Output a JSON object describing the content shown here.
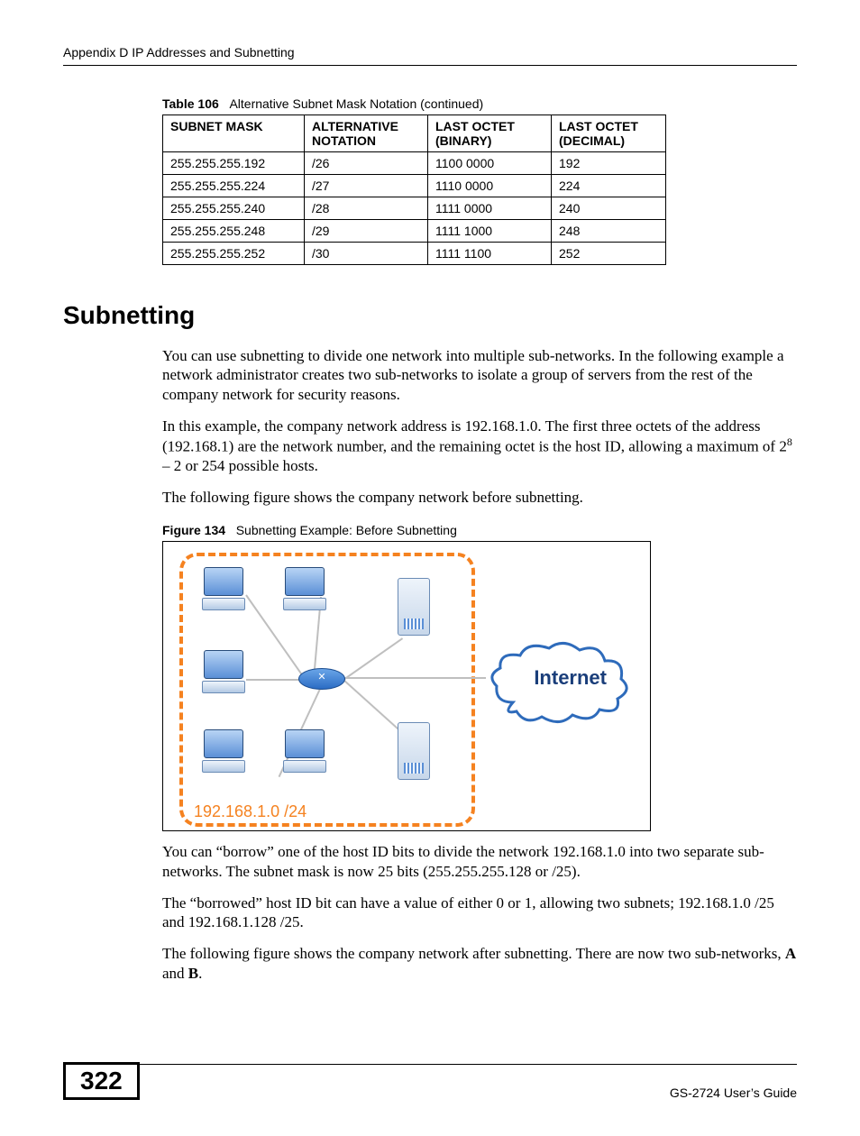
{
  "running_head": "Appendix D IP Addresses and Subnetting",
  "table": {
    "label": "Table 106",
    "title": "Alternative Subnet Mask Notation (continued)",
    "headers": [
      "SUBNET MASK",
      "ALTERNATIVE NOTATION",
      "LAST OCTET (BINARY)",
      "LAST OCTET (DECIMAL)"
    ],
    "rows": [
      [
        "255.255.255.192",
        "/26",
        "1100 0000",
        "192"
      ],
      [
        "255.255.255.224",
        "/27",
        "1110 0000",
        "224"
      ],
      [
        "255.255.255.240",
        "/28",
        "1111 0000",
        "240"
      ],
      [
        "255.255.255.248",
        "/29",
        "1111 1000",
        "248"
      ],
      [
        "255.255.255.252",
        "/30",
        "1111 1100",
        "252"
      ]
    ]
  },
  "section_title": "Subnetting",
  "paragraphs": {
    "p1": "You can use subnetting to divide one network into multiple sub-networks. In the following example a network administrator creates two sub-networks to isolate a group of servers from the rest of the company network for security reasons.",
    "p2_a": "In this example, the company network address is 192.168.1.0. The first three octets of the address (192.168.1) are the network number, and the remaining octet is the host ID, allowing a maximum of 2",
    "p2_sup": "8",
    "p2_b": " – 2 or 254 possible hosts.",
    "p3": "The following figure shows the company network before subnetting.",
    "p4": "You can “borrow” one of the host ID bits to divide the network 192.168.1.0 into two separate sub-networks. The subnet mask is now 25 bits (255.255.255.128 or /25).",
    "p5": "The “borrowed” host ID bit can have a value of either 0 or 1, allowing two subnets; 192.168.1.0 /25 and 192.168.1.128 /25.",
    "p6_a": "The following figure shows the company network after subnetting. There are now two sub-networks, ",
    "p6_b": "A",
    "p6_c": " and ",
    "p6_d": "B",
    "p6_e": "."
  },
  "figure": {
    "label": "Figure 134",
    "title": "Subnetting Example: Before Subnetting",
    "net_label": "192.168.1.0 /24",
    "cloud_label": "Internet"
  },
  "chart_data": {
    "type": "diagram",
    "description": "Network topology before subnetting",
    "nodes": [
      {
        "id": "router",
        "type": "router"
      },
      {
        "id": "pc1",
        "type": "workstation"
      },
      {
        "id": "pc2",
        "type": "workstation"
      },
      {
        "id": "pc3",
        "type": "workstation"
      },
      {
        "id": "pc4",
        "type": "workstation"
      },
      {
        "id": "srv1",
        "type": "server"
      },
      {
        "id": "srv2",
        "type": "server"
      },
      {
        "id": "internet",
        "type": "cloud",
        "label": "Internet"
      }
    ],
    "edges": [
      [
        "router",
        "pc1"
      ],
      [
        "router",
        "pc2"
      ],
      [
        "router",
        "pc3"
      ],
      [
        "router",
        "pc4"
      ],
      [
        "router",
        "srv1"
      ],
      [
        "router",
        "srv2"
      ],
      [
        "router",
        "internet"
      ]
    ],
    "subnet_boundary": {
      "label": "192.168.1.0 /24",
      "contains": [
        "router",
        "pc1",
        "pc2",
        "pc3",
        "pc4",
        "srv1",
        "srv2"
      ]
    }
  },
  "footer": {
    "page_number": "322",
    "guide": "GS-2724 User’s Guide"
  }
}
